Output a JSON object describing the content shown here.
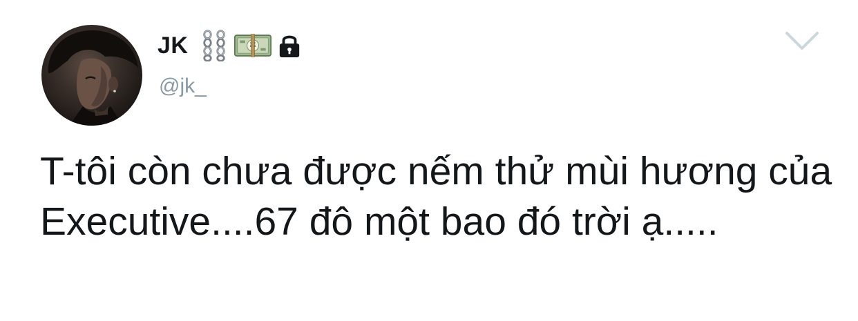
{
  "author": {
    "display_name": "JK",
    "handle": "@jk_",
    "badges": [
      "chains-icon",
      "money-with-yen-icon",
      "lock-icon"
    ]
  },
  "tweet": {
    "text": "T-tôi còn chưa được nếm thử mùi hương của Executive....67 đô một bao đó trời ạ....."
  },
  "icons": {
    "menu": "chevron-down-icon",
    "avatar": "avatar-image"
  },
  "colors": {
    "text": "#14171a",
    "secondary": "#8899a6",
    "caret": "#ccd6dd"
  }
}
